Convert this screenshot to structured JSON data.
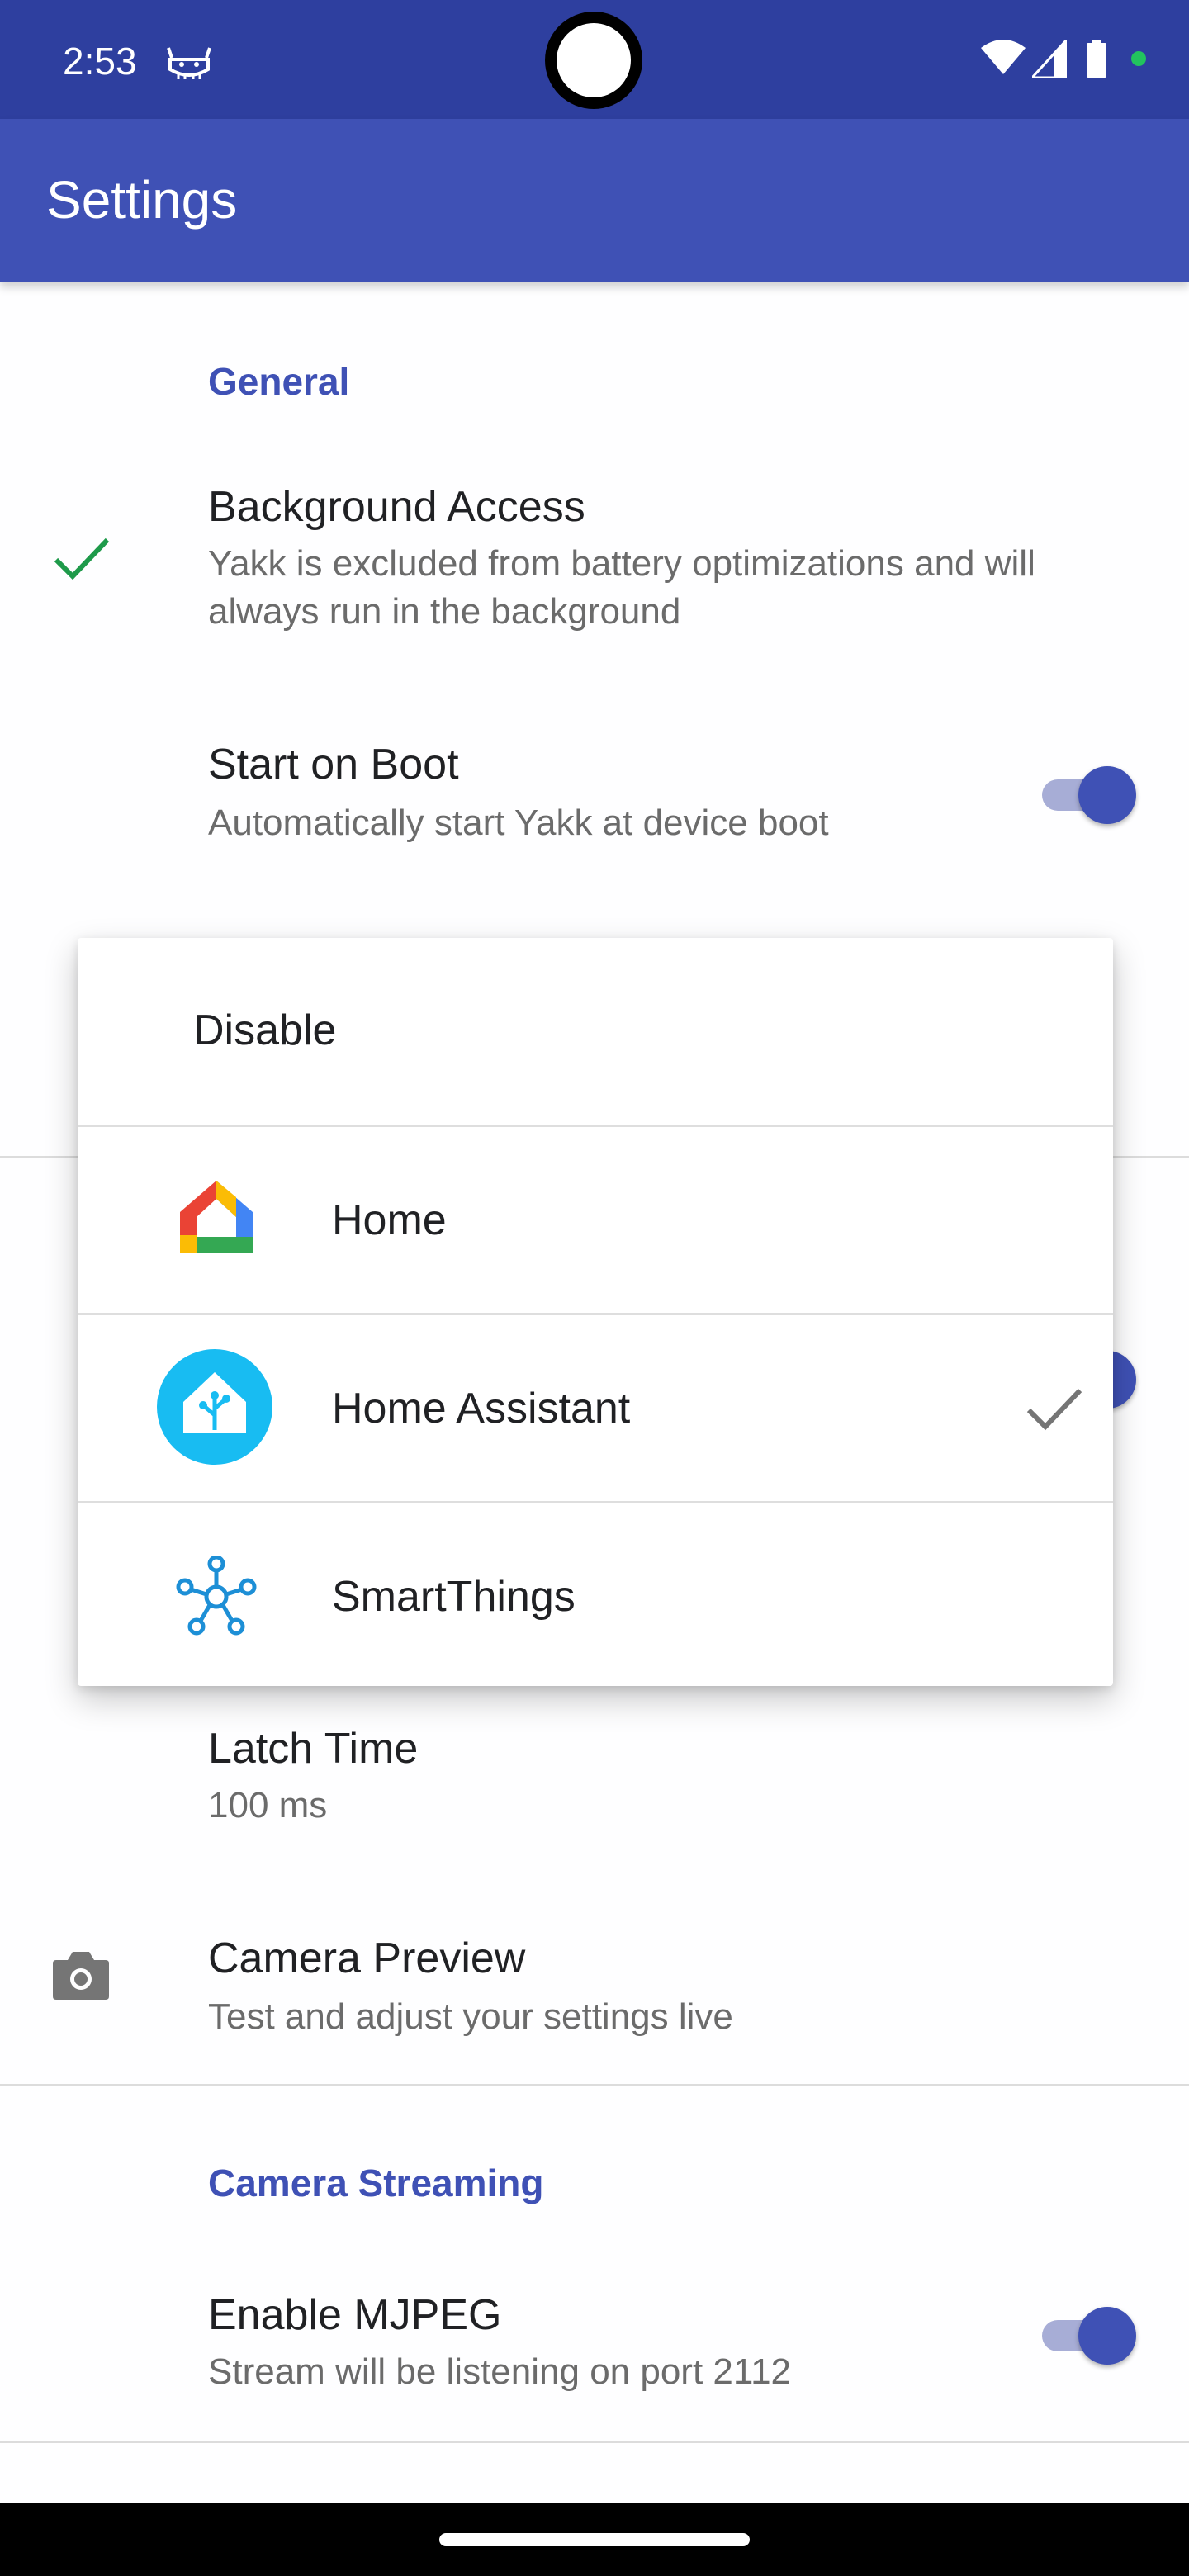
{
  "status_bar": {
    "time": "2:53",
    "notification_icon": "android-head-icon",
    "wifi_icon": "wifi-icon",
    "signal_icon": "cell-signal-icon",
    "battery_icon": "battery-icon",
    "dot_color": "#22c35e"
  },
  "app_bar": {
    "title": "Settings",
    "color": "#3f51b5"
  },
  "sections": {
    "general": {
      "header": "General",
      "background_access": {
        "title": "Background Access",
        "summary": "Yakk is excluded from battery optimizations and will always run in the background",
        "icon": "check-icon"
      },
      "start_on_boot": {
        "title": "Start on Boot",
        "summary": "Automatically start Yakk at device boot",
        "enabled": true
      }
    },
    "latch_time": {
      "title": "Latch Time",
      "summary": "100 ms"
    },
    "camera_preview": {
      "title": "Camera Preview",
      "summary": "Test and adjust your settings live",
      "icon": "camera-icon"
    },
    "camera_streaming": {
      "header": "Camera Streaming",
      "enable_mjpeg": {
        "title": "Enable MJPEG",
        "summary": "Stream will be listening on port 2112",
        "enabled": true
      }
    }
  },
  "popup": {
    "items": [
      {
        "label": "Disable",
        "icon": null,
        "selected": false
      },
      {
        "label": "Home",
        "icon": "google-home-icon",
        "selected": false
      },
      {
        "label": "Home Assistant",
        "icon": "home-assistant-icon",
        "selected": true
      },
      {
        "label": "SmartThings",
        "icon": "smartthings-icon",
        "selected": false
      }
    ]
  }
}
